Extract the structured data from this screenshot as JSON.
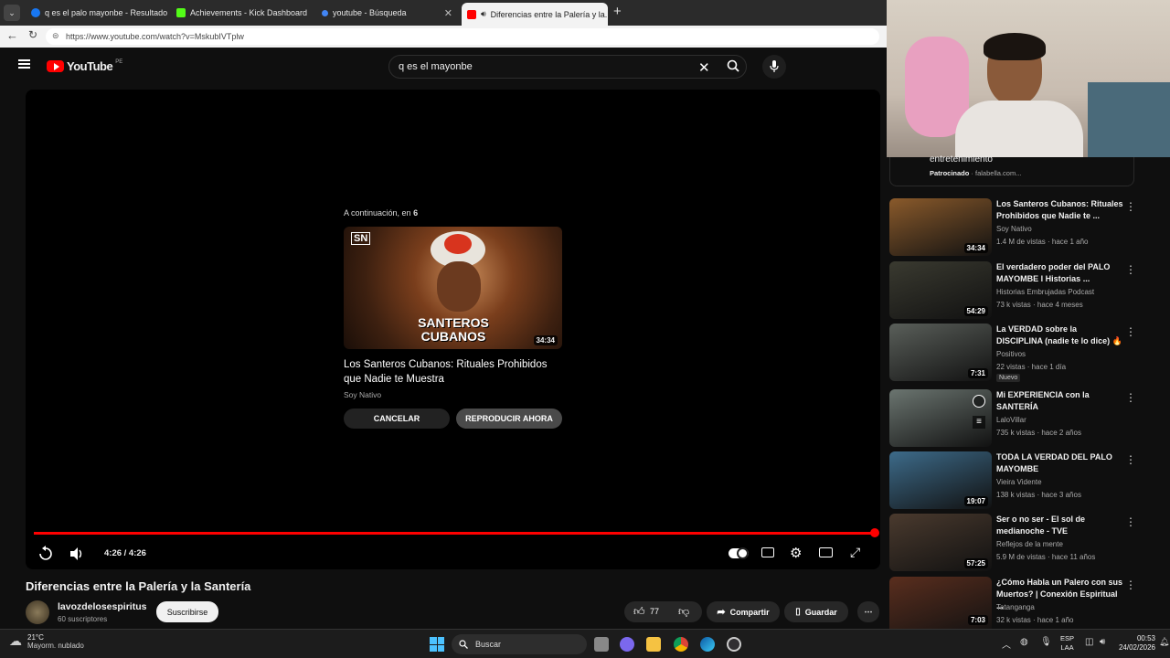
{
  "browser": {
    "tabs": [
      {
        "label": "q es el palo mayonbe - Resultado...",
        "color": "#1877f2"
      },
      {
        "label": "Achievements - Kick Dashboard",
        "color": "#53fc18"
      },
      {
        "label": "youtube - Búsqueda",
        "color": "#4285f4"
      },
      {
        "label": "Diferencias entre la Palería y la...",
        "color": "#ff0000"
      }
    ],
    "url": "https://www.youtube.com/watch?v=MskubIVTplw"
  },
  "yt": {
    "logo": "YouTube",
    "region": "PE",
    "search_value": "q es el mayonbe"
  },
  "player": {
    "up_next_label": "A continuación, en",
    "countdown": "6",
    "next_thumb_text": "SANTEROS CUBANOS",
    "next_duration": "34:34",
    "next_title": "Los Santeros Cubanos: Rituales Prohibidos que Nadie te Muestra",
    "next_channel": "Soy Nativo",
    "cancel_label": "CANCELAR",
    "play_now_label": "REPRODUCIR AHORA",
    "time": "4:26 / 4:26",
    "progress": 1.0
  },
  "video": {
    "title": "Diferencias entre la Palería y la Santería",
    "channel": "lavozdelosespiritus",
    "subscribers": "60 suscriptores",
    "subscribe_label": "Suscribirse",
    "likes": "77",
    "share_label": "Compartir",
    "save_label": "Guardar"
  },
  "sidebar": {
    "ad_text": "entretenimiento",
    "ad_sponsored": "Patrocinado",
    "ad_domain": "falabella.com...",
    "items": [
      {
        "title": "Los Santeros Cubanos: Rituales Prohibidos que Nadie te ...",
        "channel": "Soy Nativo",
        "meta": "1.4 M de vistas · hace 1 año",
        "duration": "34:34",
        "thumb": "#8a5a2b"
      },
      {
        "title": "El verdadero poder del PALO MAYOMBE l Historias ...",
        "channel": "Historias Embrujadas Podcast",
        "meta": "73 k vistas · hace 4 meses",
        "duration": "54:29",
        "thumb": "#3a3a30"
      },
      {
        "title": "La VERDAD sobre la DISCIPLINA (nadie te lo dice) 🔥",
        "channel": "Positivos",
        "meta": "22 vistas · hace 1 día",
        "duration": "7:31",
        "thumb": "#5a5f5a",
        "badge": "Nuevo"
      },
      {
        "title": "Mi EXPERIENCIA con la SANTERÍA",
        "channel": "LaloVillar",
        "meta": "735 k vistas · hace 2 años",
        "duration": "",
        "thumb": "#6b7570"
      },
      {
        "title": "TODA LA VERDAD DEL PALO MAYOMBE",
        "channel": "Vieira Vidente",
        "meta": "138 k vistas · hace 3 años",
        "duration": "19:07",
        "thumb": "#3d6b8a"
      },
      {
        "title": "Ser o no ser - El sol de medianoche - TVE",
        "channel": "Reflejos de la mente",
        "meta": "5.9 M de vistas · hace 11 años",
        "duration": "57:25",
        "thumb": "#4a3a2e"
      },
      {
        "title": "¿Cómo Habla un Palero con sus Muertos? | Conexión Espiritual ...",
        "channel": "Tatanganga",
        "meta": "32 k vistas · hace 1 año",
        "duration": "7:03",
        "thumb": "#5a2e1e"
      }
    ]
  },
  "taskbar": {
    "temp": "21°C",
    "weather": "Mayorm. nublado",
    "search_label": "Buscar",
    "lang": "ESP",
    "lang2": "LAA",
    "time": "00:53",
    "date": "24/02/2026"
  }
}
